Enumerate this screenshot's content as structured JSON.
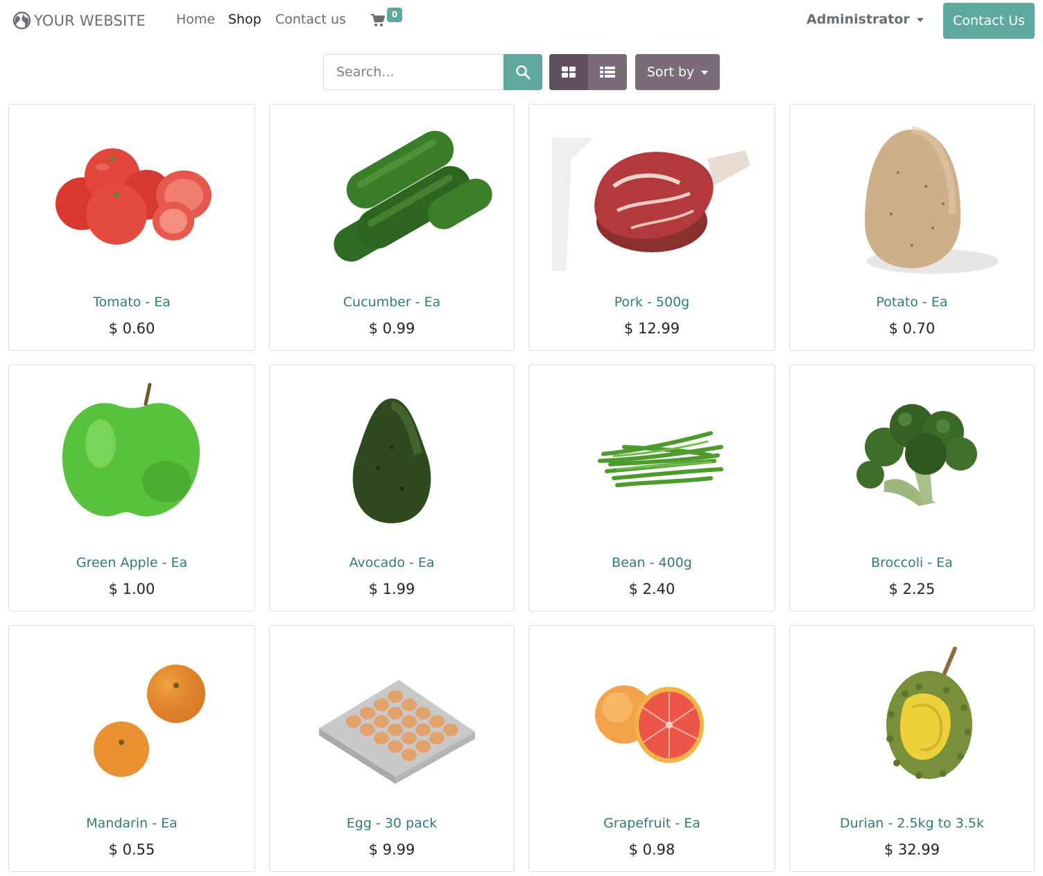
{
  "brand": {
    "name": "YOUR WEBSITE",
    "icon": "globe-icon"
  },
  "nav": {
    "items": [
      {
        "label": "Home"
      },
      {
        "label": "Shop"
      },
      {
        "label": "Contact us"
      }
    ],
    "active": "Shop",
    "cart_icon": "cart-icon",
    "cart_count": "0",
    "user": "Administrator",
    "cta_label": "Contact Us"
  },
  "toolbar": {
    "search_placeholder": "Search...",
    "search_icon": "search-icon",
    "grid_icon": "grid-view-icon",
    "list_icon": "list-view-icon",
    "sort_label": "Sort by"
  },
  "colors": {
    "accent": "#5fa89e",
    "secondary": "#7a6c79",
    "secondary_dark": "#5d4f5c",
    "product_name": "#347a70"
  },
  "products": [
    {
      "name": "Tomato - Ea",
      "price": "$ 0.60",
      "image": "tomato-image"
    },
    {
      "name": "Cucumber - Ea",
      "price": "$ 0.99",
      "image": "cucumber-image"
    },
    {
      "name": "Pork - 500g",
      "price": "$ 12.99",
      "image": "pork-image"
    },
    {
      "name": "Potato - Ea",
      "price": "$ 0.70",
      "image": "potato-image"
    },
    {
      "name": "Green Apple - Ea",
      "price": "$ 1.00",
      "image": "green-apple-image"
    },
    {
      "name": "Avocado - Ea",
      "price": "$ 1.99",
      "image": "avocado-image"
    },
    {
      "name": "Bean - 400g",
      "price": "$ 2.40",
      "image": "bean-image"
    },
    {
      "name": "Broccoli - Ea",
      "price": "$ 2.25",
      "image": "broccoli-image"
    },
    {
      "name": "Mandarin - Ea",
      "price": "$ 0.55",
      "image": "mandarin-image"
    },
    {
      "name": "Egg - 30 pack",
      "price": "$ 9.99",
      "image": "egg-image"
    },
    {
      "name": "Grapefruit - Ea",
      "price": "$ 0.98",
      "image": "grapefruit-image"
    },
    {
      "name": "Durian - 2.5kg to 3.5k",
      "price": "$ 32.99",
      "image": "durian-image"
    }
  ]
}
